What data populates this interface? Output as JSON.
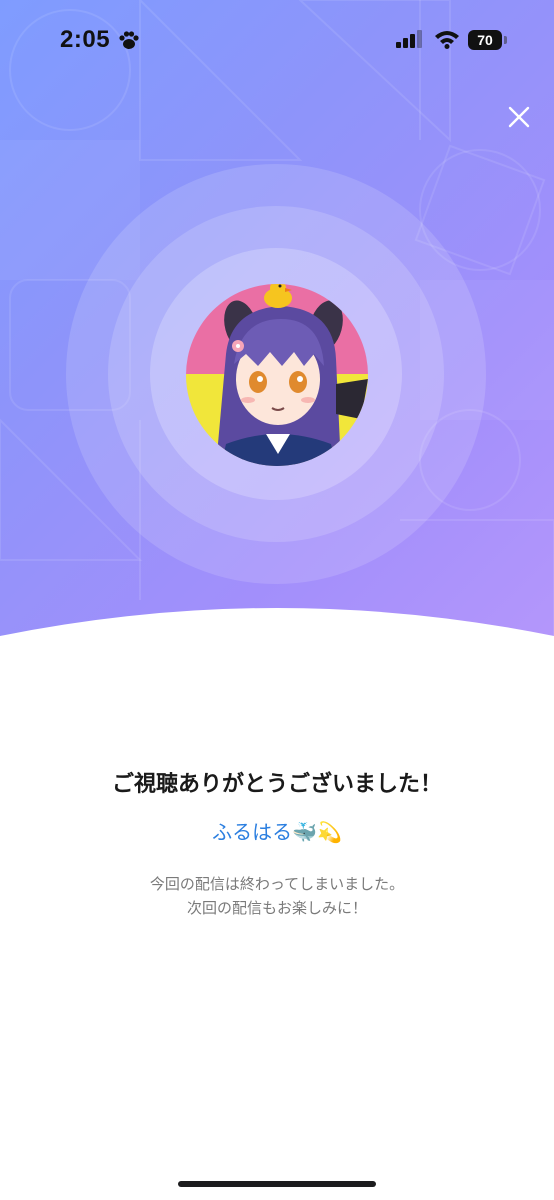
{
  "status_bar": {
    "time": "2:05",
    "battery": "70"
  },
  "icons": {
    "paw": "paw-icon",
    "signal": "cellular-signal-icon",
    "wifi": "wifi-icon",
    "battery": "battery-icon",
    "close": "close-icon"
  },
  "colors": {
    "accent_link": "#2c7fe0",
    "gradient_start": "#7f9cff",
    "gradient_end": "#b597fb"
  },
  "end_screen": {
    "title": "ご視聴ありがとうございました！",
    "streamer_name": "ふるはる",
    "streamer_emoji": "🐳💫",
    "message_line1": "今回の配信は終わってしまいました。",
    "message_line2": "次回の配信もお楽しみに！"
  }
}
